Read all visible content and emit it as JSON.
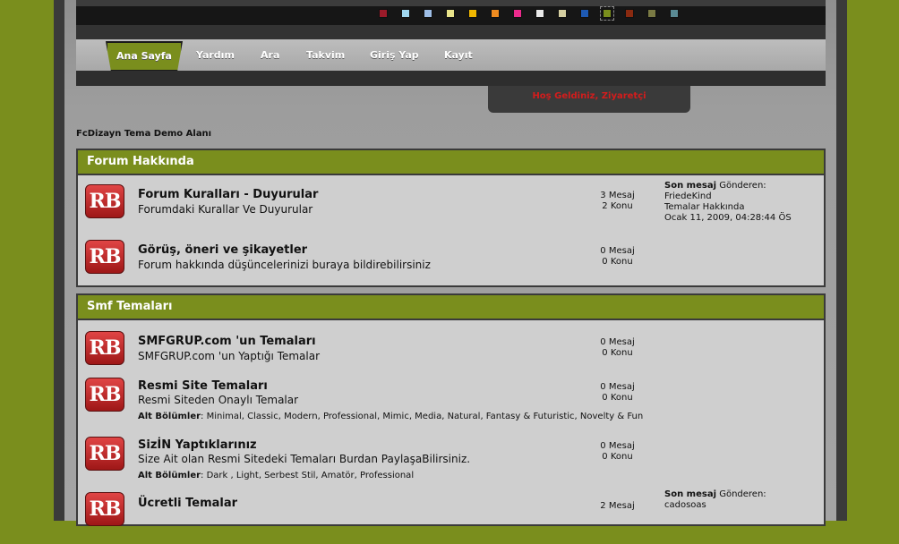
{
  "theme": {
    "swatches": [
      "#9c1b2a",
      "#9fd6ef",
      "#9ebee6",
      "#e8e38a",
      "#f0b700",
      "#f08c20",
      "#ec2a8c",
      "#e8e8e8",
      "#d6cfa2",
      "#1e5ab4",
      "#7a8e1d",
      "#8a2a10",
      "#7a7a44",
      "#5a8a94"
    ],
    "active_swatch": 10
  },
  "nav": {
    "items": [
      "Ana Sayfa",
      "Yardım",
      "Ara",
      "Takvim",
      "Giriş Yap",
      "Kayıt"
    ]
  },
  "welcome": "Hoş Geldiniz, Ziyaretçi",
  "linktree": "FcDizayn Tema Demo Alanı",
  "categories": [
    {
      "title": "Forum Hakkında",
      "boards": [
        {
          "icon": "RB",
          "title": "Forum Kuralları - Duyurular",
          "desc": "Forumdaki Kurallar Ve Duyurular",
          "posts": "3 Mesaj",
          "topics": "2 Konu",
          "last_label": "Son mesaj",
          "last_by": "Gönderen:",
          "last_user": "FriedeKind",
          "last_topic": "Temalar Hakkında",
          "last_date": "Ocak 11, 2009, 04:28:44 ÖS"
        },
        {
          "icon": "RB",
          "title": "Görüş, öneri ve şikayetler",
          "desc": "Forum hakkında düşüncelerinizi buraya bildirebilirsiniz",
          "posts": "0 Mesaj",
          "topics": "0 Konu"
        }
      ]
    },
    {
      "title": "Smf Temaları",
      "boards": [
        {
          "icon": "RB",
          "title": "SMFGRUP.com 'un Temaları",
          "desc": "SMFGRUP.com 'un Yaptığı Temalar",
          "posts": "0 Mesaj",
          "topics": "0 Konu"
        },
        {
          "icon": "RB",
          "title": "Resmi Site Temaları",
          "desc": "Resmi Siteden Onaylı Temalar",
          "posts": "0 Mesaj",
          "topics": "0 Konu",
          "sub_label": "Alt Bölümler",
          "sub_list": "Minimal, Classic, Modern, Professional, Mimic, Media, Natural, Fantasy & Futuristic, Novelty & Fun"
        },
        {
          "icon": "RB",
          "title": "SizİN Yaptıklarınız",
          "desc": "Size Ait olan Resmi Sitedeki Temaları Burdan PaylaşaBilirsiniz.",
          "posts": "0 Mesaj",
          "topics": "0 Konu",
          "sub_label": "Alt Bölümler",
          "sub_list": "Dark , Light, Serbest Stil, Amatör, Professional"
        },
        {
          "icon": "RB",
          "title": "Ücretli Temalar",
          "desc": "",
          "posts": "2 Mesaj",
          "topics": "",
          "last_label": "Son mesaj",
          "last_by": "Gönderen:",
          "last_user": "cadosoas"
        }
      ]
    }
  ]
}
